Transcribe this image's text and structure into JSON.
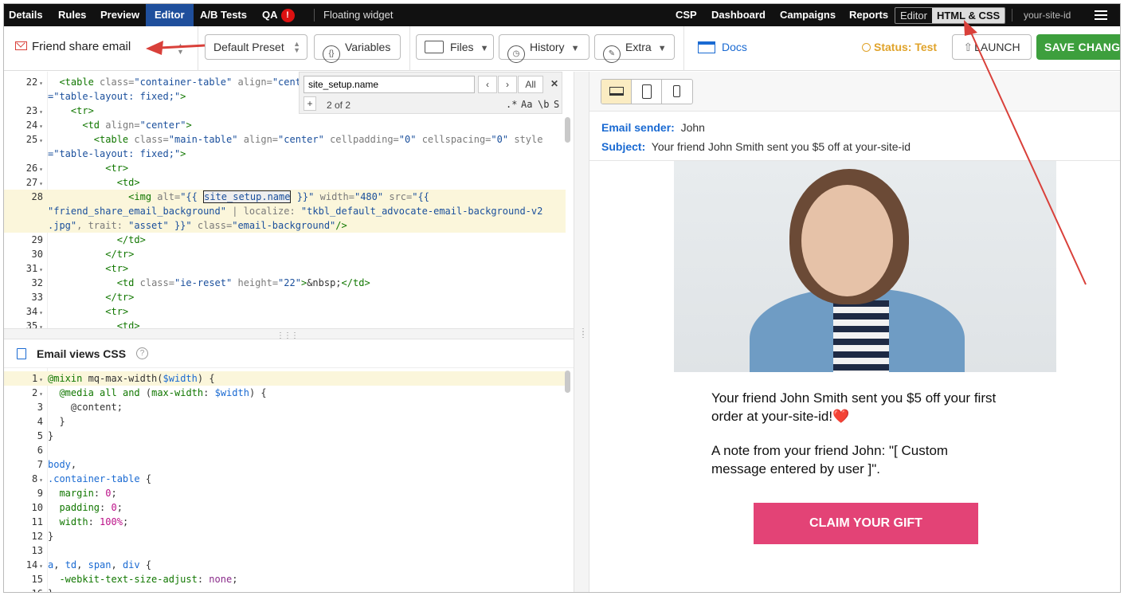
{
  "topbar": {
    "tabs": [
      {
        "label": "Details"
      },
      {
        "label": "Rules"
      },
      {
        "label": "Preview"
      },
      {
        "label": "Editor"
      },
      {
        "label": "A/B Tests"
      },
      {
        "label": "QA"
      }
    ],
    "qa_badge": "!",
    "widget": "Floating widget",
    "right_links": [
      {
        "label": "CSP"
      },
      {
        "label": "Dashboard"
      },
      {
        "label": "Campaigns"
      },
      {
        "label": "Reports"
      }
    ],
    "switch": {
      "off": "Editor",
      "on": "HTML & CSS"
    },
    "site_id": "your-site-id"
  },
  "toolbar": {
    "title": "Friend share email",
    "preset": "Default Preset",
    "variables": "Variables",
    "files": "Files",
    "history": "History",
    "extra": "Extra",
    "docs": "Docs",
    "status": "Status: Test",
    "launch": "LAUNCH",
    "save": "SAVE CHANGES"
  },
  "search": {
    "value": "site_setup.name",
    "count": "2 of 2",
    "all": "All",
    "plus": "+",
    "opts": [
      ".*",
      "Aa",
      "\\b",
      "S"
    ]
  },
  "css_section": {
    "title": "Email views CSS",
    "help": "?"
  },
  "preview": {
    "sender_label": "Email sender:",
    "sender": "John",
    "subject_label": "Subject:",
    "subject": "Your friend John Smith sent you $5 off at your-site-id",
    "line1": "Your friend John Smith sent you $5 off your first",
    "line2": "order at your-site-id!",
    "heart": "❤️",
    "note1": "A note from your friend John: \"[ Custom",
    "note2": "message entered by user ]\".",
    "cta": "CLAIM YOUR GIFT"
  },
  "code_lines": [
    {
      "n": "22",
      "fold": true,
      "html": "  <span class=\"t\">&lt;table</span> <span class=\"a\">class=</span><span class=\"s\">\"container-table\"</span> <span class=\"a\">align=</span><span class=\"s\">\"cent</span>"
    },
    {
      "n": "",
      "html": "<span class=\"s\">=\"table-layout: fixed;\"</span><span class=\"t\">&gt;</span>"
    },
    {
      "n": "23",
      "fold": true,
      "html": "    <span class=\"t\">&lt;tr&gt;</span>"
    },
    {
      "n": "24",
      "fold": true,
      "html": "      <span class=\"t\">&lt;td</span> <span class=\"a\">align=</span><span class=\"s\">\"center\"</span><span class=\"t\">&gt;</span>"
    },
    {
      "n": "25",
      "fold": true,
      "html": "        <span class=\"t\">&lt;table</span> <span class=\"a\">class=</span><span class=\"s\">\"main-table\"</span> <span class=\"a\">align=</span><span class=\"s\">\"center\"</span> <span class=\"a\">cellpadding=</span><span class=\"s\">\"0\"</span> <span class=\"a\">cellspacing=</span><span class=\"s\">\"0\"</span> <span class=\"a\">style</span>"
    },
    {
      "n": "",
      "html": "<span class=\"s\">=\"table-layout: fixed;\"</span><span class=\"t\">&gt;</span>"
    },
    {
      "n": "26",
      "fold": true,
      "html": "          <span class=\"t\">&lt;tr&gt;</span>"
    },
    {
      "n": "27",
      "fold": true,
      "html": "            <span class=\"t\">&lt;td&gt;</span>"
    },
    {
      "n": "28",
      "hl": true,
      "html": "              <span class=\"t\">&lt;img</span> <span class=\"a\">alt=</span><span class=\"s\">\"{{ <span class=\"sel\">site_setup.name</span> }}\"</span> <span class=\"a\">width=</span><span class=\"s\">\"480\"</span> <span class=\"a\">src=</span><span class=\"s\">\"{{</span>"
    },
    {
      "n": "",
      "hl": true,
      "html": "<span class=\"s\">\"friend_share_email_background\"</span> <span class=\"a\">| localize:</span> <span class=\"s\">\"tkbl_default_advocate-email-background-v2</span>"
    },
    {
      "n": "",
      "hl": true,
      "html": "<span class=\"s\">.jpg\"</span><span class=\"a\">, trait:</span> <span class=\"s\">\"asset\" }}\"</span> <span class=\"a\">class=</span><span class=\"s\">\"email-background\"</span><span class=\"t\">/&gt;</span>"
    },
    {
      "n": "29",
      "html": "            <span class=\"t\">&lt;/td&gt;</span>"
    },
    {
      "n": "30",
      "html": "          <span class=\"t\">&lt;/tr&gt;</span>"
    },
    {
      "n": "31",
      "fold": true,
      "html": "          <span class=\"t\">&lt;tr&gt;</span>"
    },
    {
      "n": "32",
      "html": "            <span class=\"t\">&lt;td</span> <span class=\"a\">class=</span><span class=\"s\">\"ie-reset\"</span> <span class=\"a\">height=</span><span class=\"s\">\"22\"</span><span class=\"t\">&gt;</span>&amp;nbsp;<span class=\"t\">&lt;/td&gt;</span>"
    },
    {
      "n": "33",
      "html": "          <span class=\"t\">&lt;/tr&gt;</span>"
    },
    {
      "n": "34",
      "fold": true,
      "html": "          <span class=\"t\">&lt;tr&gt;</span>"
    },
    {
      "n": "35",
      "fold": true,
      "html": "            <span class=\"t\">&lt;td&gt;</span>"
    }
  ],
  "css_lines": [
    {
      "n": "1",
      "fold": true,
      "hl": true,
      "html": "<span class=\"p\">@mixin</span> mq-max-width(<span class=\"v\">$width</span>) {"
    },
    {
      "n": "2",
      "fold": true,
      "html": "  <span class=\"p\">@media</span> <span class=\"p\">all</span> <span class=\"p\">and</span> (<span class=\"p\">max-width</span>: <span class=\"v\">$width</span>) {"
    },
    {
      "n": "3",
      "html": "    @content;"
    },
    {
      "n": "4",
      "html": "  }"
    },
    {
      "n": "5",
      "html": "}"
    },
    {
      "n": "6",
      "html": ""
    },
    {
      "n": "7",
      "html": "<span class=\"v\">body</span>,"
    },
    {
      "n": "8",
      "fold": true,
      "html": "<span class=\"v\">.container-table</span> {"
    },
    {
      "n": "9",
      "html": "  <span class=\"p\">margin</span>: <span class=\"n\">0</span>;"
    },
    {
      "n": "10",
      "html": "  <span class=\"p\">padding</span>: <span class=\"n\">0</span>;"
    },
    {
      "n": "11",
      "html": "  <span class=\"p\">width</span>: <span class=\"n\">100%</span>;"
    },
    {
      "n": "12",
      "html": "}"
    },
    {
      "n": "13",
      "html": ""
    },
    {
      "n": "14",
      "fold": true,
      "html": "<span class=\"v\">a</span>, <span class=\"v\">td</span>, <span class=\"v\">span</span>, <span class=\"v\">div</span> {"
    },
    {
      "n": "15",
      "html": "  <span class=\"p\">-webkit-text-size-adjust</span>: <span class=\"k\">none</span>;"
    },
    {
      "n": "16",
      "html": "}"
    }
  ]
}
